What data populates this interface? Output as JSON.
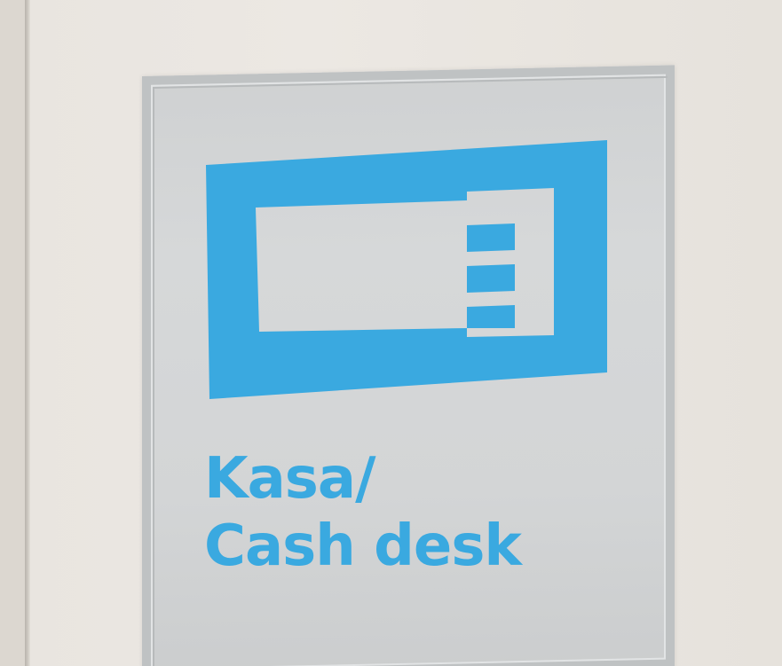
{
  "sign": {
    "line1": "Kasa/",
    "line2": "Cash desk",
    "icon": "cash-register-card-icon",
    "text_color": "#3aa9e0",
    "panel_color": "#d4d6d7",
    "wall_color": "#ebe7e2"
  }
}
